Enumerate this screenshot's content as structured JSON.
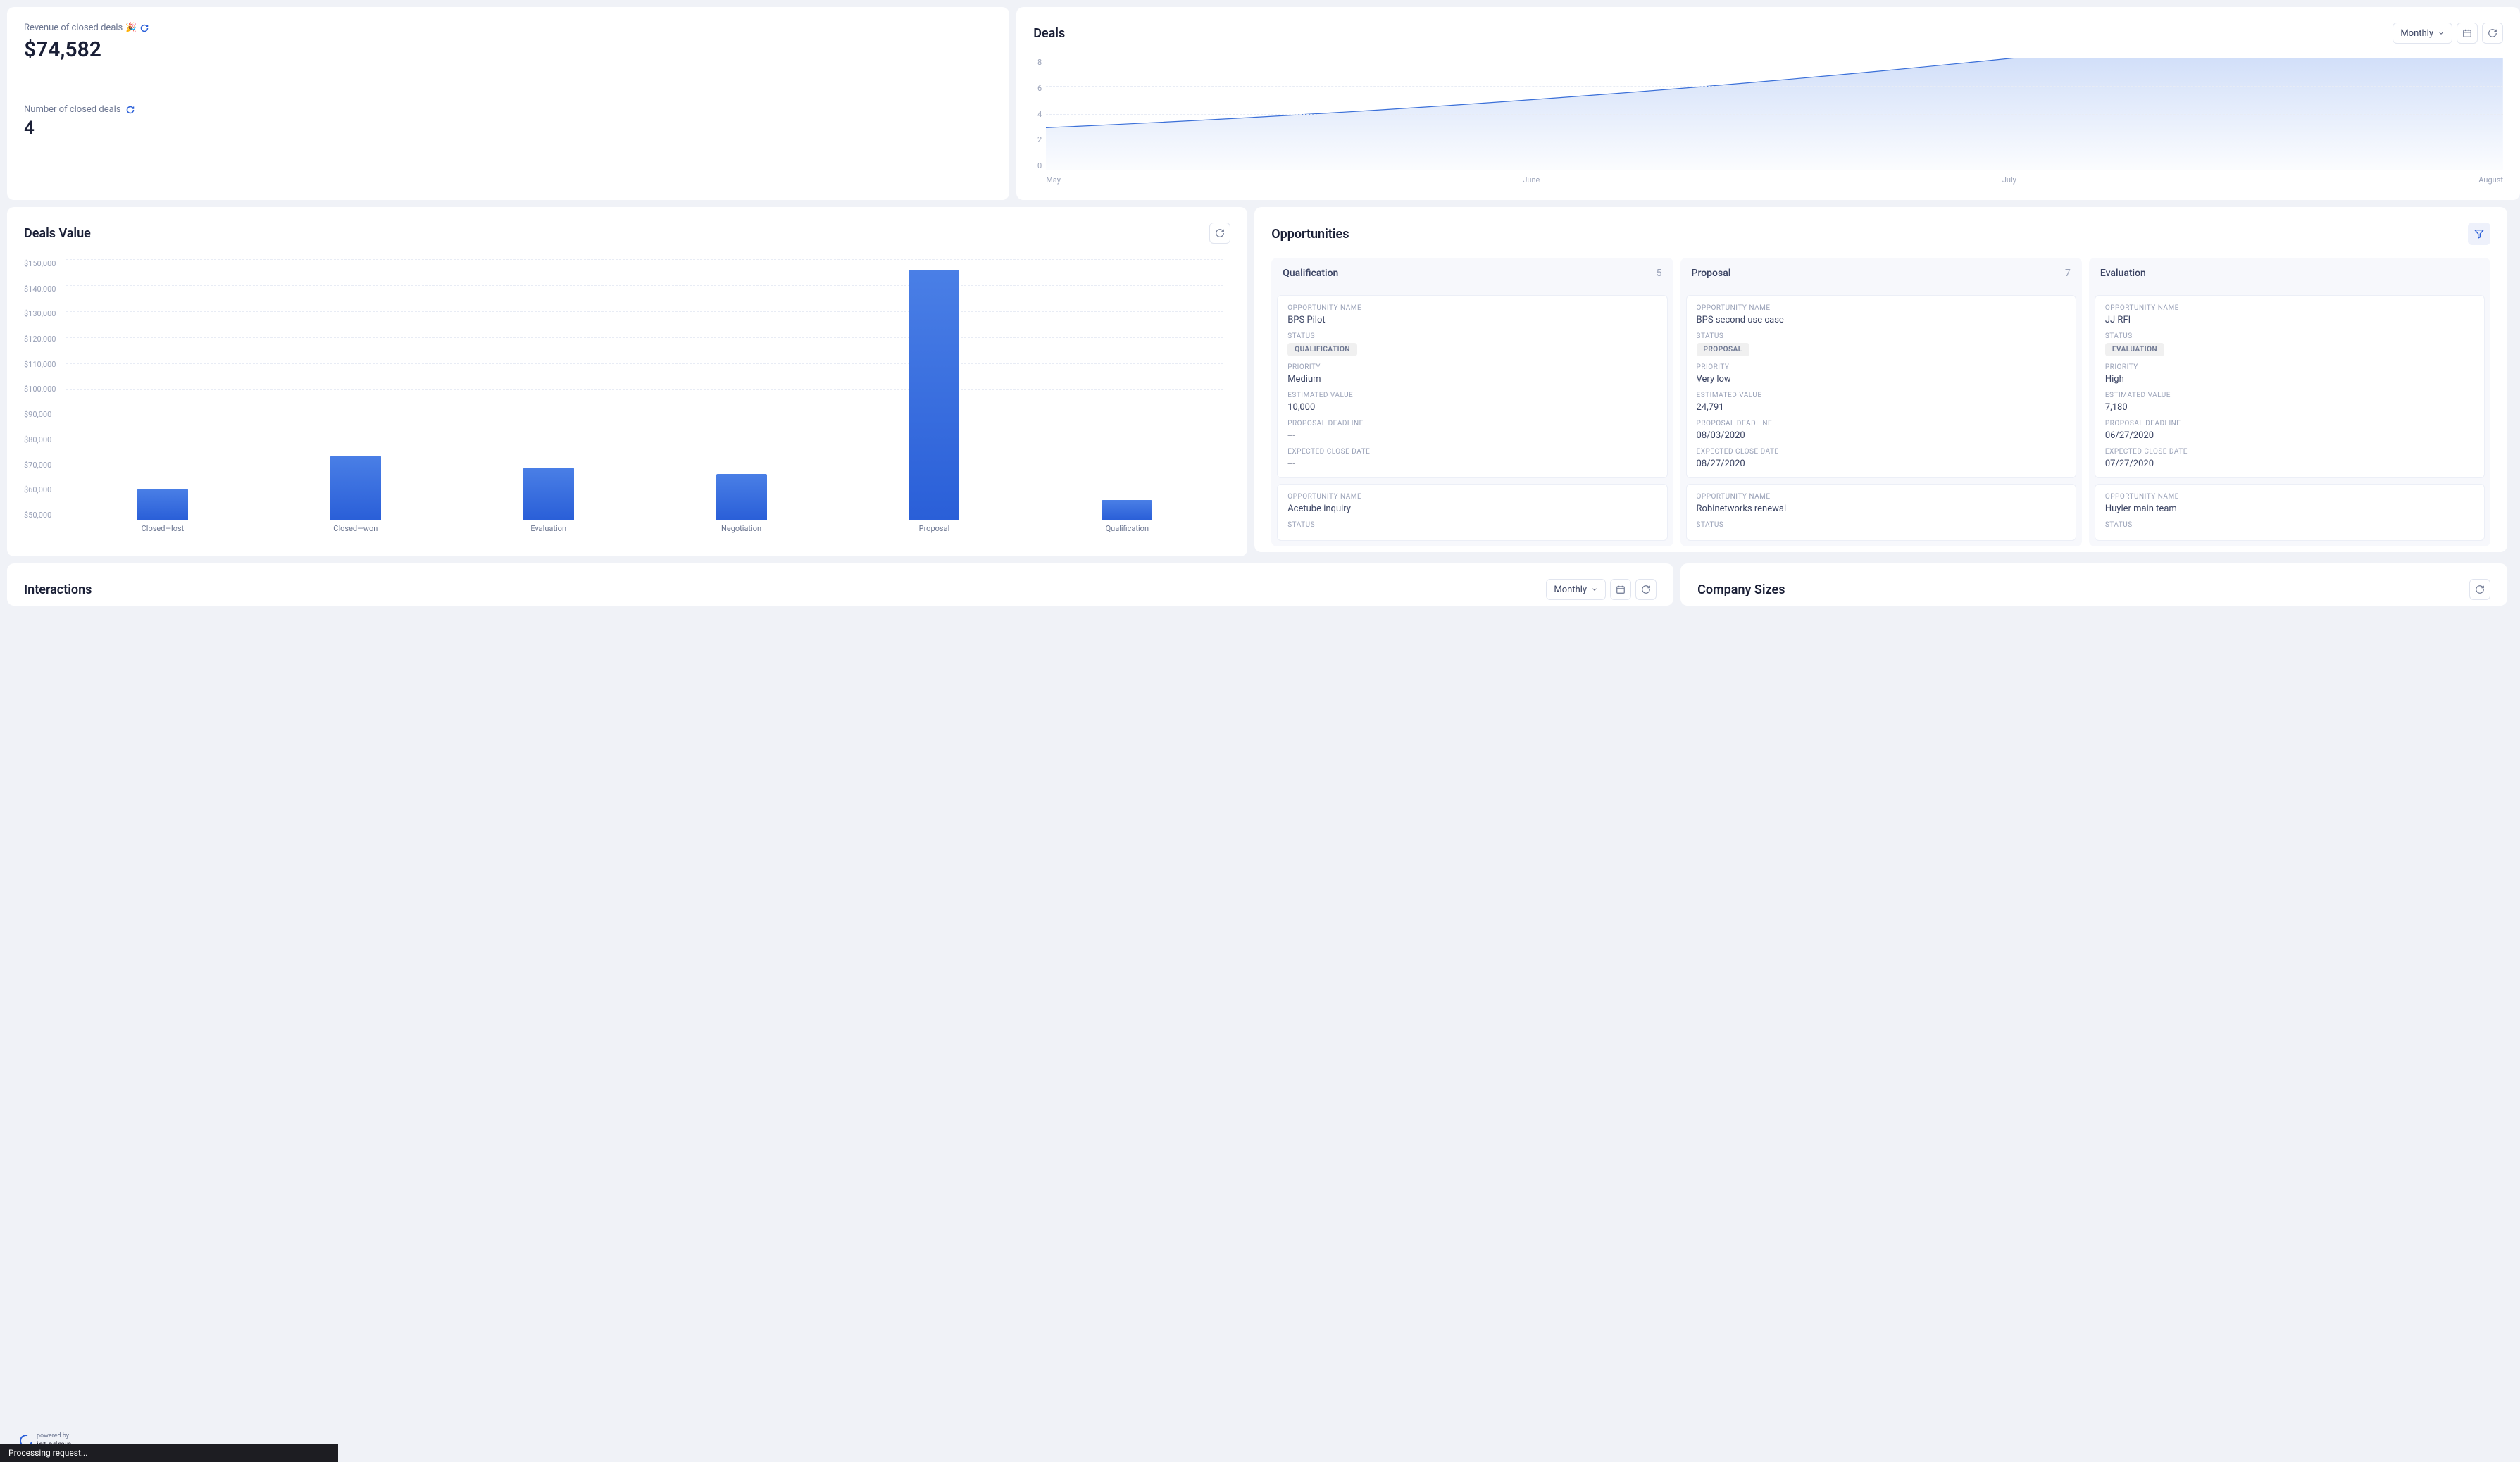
{
  "revenue": {
    "label": "Revenue of closed deals",
    "emoji": "🎉",
    "value": "$74,582"
  },
  "closed_count": {
    "label": "Number of closed deals",
    "value": "4"
  },
  "deals_chart": {
    "title": "Deals",
    "period_label": "Monthly"
  },
  "deals_value": {
    "title": "Deals Value"
  },
  "opportunities": {
    "title": "Opportunities",
    "labels": {
      "opportunity_name": "OPPORTUNITY NAME",
      "status": "STATUS",
      "priority": "PRIORITY",
      "estimated_value": "ESTIMATED VALUE",
      "proposal_deadline": "PROPOSAL DEADLINE",
      "expected_close_date": "EXPECTED CLOSE DATE"
    },
    "columns": [
      {
        "name": "Qualification",
        "count": "5",
        "cards": [
          {
            "name": "BPS Pilot",
            "status": "QUALIFICATION",
            "priority": "Medium",
            "estimated_value": "10,000",
            "proposal_deadline": "---",
            "expected_close_date": "---"
          },
          {
            "name": "Acetube inquiry"
          }
        ]
      },
      {
        "name": "Proposal",
        "count": "7",
        "cards": [
          {
            "name": "BPS second use case",
            "status": "PROPOSAL",
            "priority": "Very low",
            "estimated_value": "24,791",
            "proposal_deadline": "08/03/2020",
            "expected_close_date": "08/27/2020"
          },
          {
            "name": "Robinetworks renewal"
          }
        ]
      },
      {
        "name": "Evaluation",
        "count": "",
        "cards": [
          {
            "name": "JJ RFI",
            "status": "EVALUATION",
            "priority": "High",
            "estimated_value": "7,180",
            "proposal_deadline": "06/27/2020",
            "expected_close_date": "07/27/2020"
          },
          {
            "name": "Huyler main team"
          }
        ]
      }
    ]
  },
  "interactions": {
    "title": "Interactions",
    "period_label": "Monthly"
  },
  "company_sizes": {
    "title": "Company Sizes"
  },
  "jet": {
    "powered": "powered by",
    "name": "jet admin"
  },
  "processing": "Processing request...",
  "chart_data": [
    {
      "type": "area",
      "title": "Deals",
      "x": [
        "May",
        "June",
        "July",
        "August"
      ],
      "values": [
        3,
        5,
        8,
        8
      ],
      "ylim": [
        0,
        8
      ],
      "yticks": [
        0,
        2,
        4,
        6,
        8
      ]
    },
    {
      "type": "bar",
      "title": "Deals Value",
      "categories": [
        "Closed—lost",
        "Closed—won",
        "Evaluation",
        "Negotiation",
        "Proposal",
        "Qualification"
      ],
      "values": [
        62000,
        74500,
        70000,
        67500,
        146000,
        57500
      ],
      "ylim": [
        50000,
        150000
      ],
      "yticks": [
        "$150,000",
        "$140,000",
        "$130,000",
        "$120,000",
        "$110,000",
        "$100,000",
        "$90,000",
        "$80,000",
        "$70,000",
        "$60,000",
        "$50,000"
      ],
      "ylabel": ""
    }
  ]
}
